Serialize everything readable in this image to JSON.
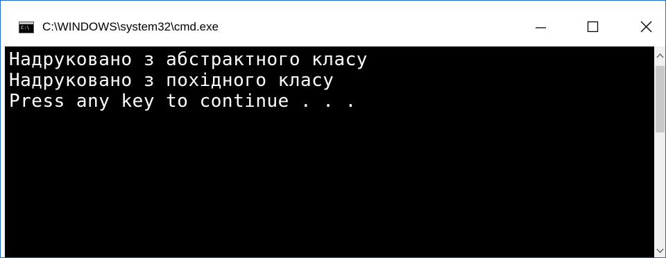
{
  "window": {
    "title": "C:\\WINDOWS\\system32\\cmd.exe",
    "app_icon": "cmd-icon",
    "app_icon_text": "C:\\",
    "controls": {
      "minimize_icon": "minimize-icon",
      "maximize_icon": "maximize-icon",
      "close_icon": "close-icon"
    }
  },
  "console": {
    "lines": [
      "Надруковано з абстрактного класу",
      "Надруковано з похідного класу",
      "Press any key to continue . . ."
    ]
  },
  "scrollbar": {
    "up_icon": "scroll-up-arrow-icon",
    "down_icon": "scroll-down-arrow-icon"
  },
  "colors": {
    "console_background": "#000000",
    "console_text": "#ffffff",
    "title_background": "#ffffff",
    "window_border": "#1a6bd1",
    "scrollbar_track": "#f0f0f0",
    "scrollbar_thumb": "#c9c9c9"
  }
}
